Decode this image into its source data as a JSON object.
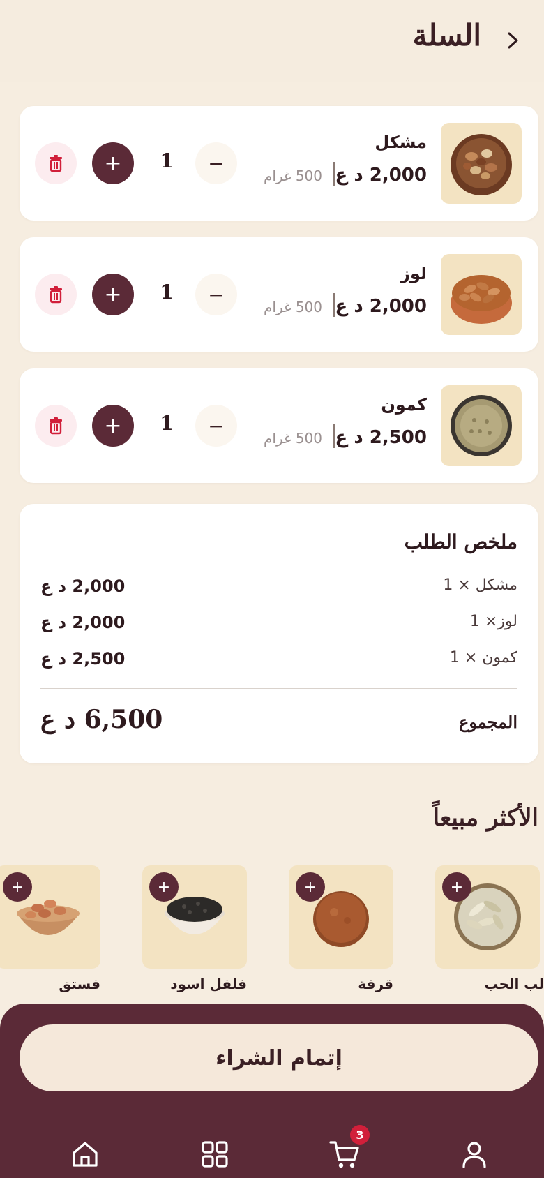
{
  "header": {
    "title": "السلة"
  },
  "cart_items": [
    {
      "name": "مشكل",
      "price": "2,000 د ع",
      "weight": "500 غرام",
      "qty": "1"
    },
    {
      "name": "لوز",
      "price": "2,000 د ع",
      "weight": "500 غرام",
      "qty": "1"
    },
    {
      "name": "كمون",
      "price": "2,500 د ع",
      "weight": "500 غرام",
      "qty": "1"
    }
  ],
  "controls": {
    "plus": "+",
    "minus": "−"
  },
  "summary": {
    "title": "ملخص الطلب",
    "rows": [
      {
        "label": "مشكل × 1",
        "amount": "2,000 د ع"
      },
      {
        "label": "لوز× 1",
        "amount": "2,000 د ع"
      },
      {
        "label": "كمون × 1",
        "amount": "2,500 د ع"
      }
    ],
    "total_label": "المجموع",
    "total_amount": "6,500 د ع"
  },
  "bestsellers": {
    "title": "الأكثر مبيعاً",
    "items": [
      {
        "name": "لب الحب"
      },
      {
        "name": "قرفة"
      },
      {
        "name": "فلفل اسود"
      },
      {
        "name": "فستق"
      }
    ]
  },
  "checkout": {
    "label": "إتمام الشراء"
  },
  "nav": {
    "cart_badge": "3"
  },
  "colors": {
    "primary": "#5b2a37",
    "background": "#f6ede0",
    "thumb_bg": "#f3e3c2",
    "delete": "#d11f3a"
  }
}
